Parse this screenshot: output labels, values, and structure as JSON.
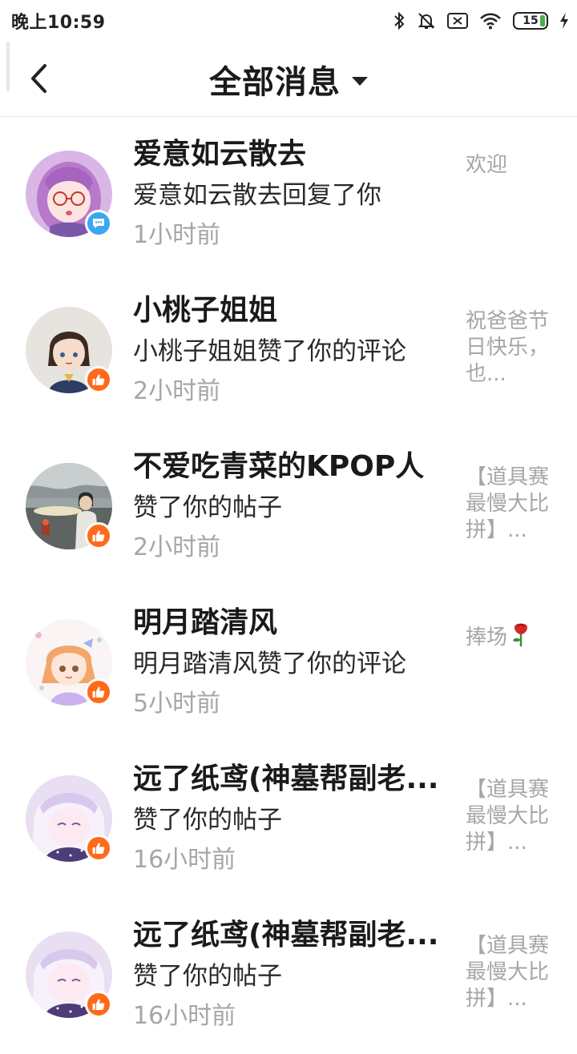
{
  "status_bar": {
    "time": "晚上10:59",
    "battery": "15",
    "icons": [
      "bluetooth-icon",
      "bell-muted-icon",
      "sim-off-icon",
      "wifi-icon",
      "battery-icon",
      "charging-icon"
    ]
  },
  "header": {
    "title": "全部消息",
    "back_icon": "chevron-left-icon",
    "dropdown_icon": "caret-down-icon"
  },
  "colors": {
    "like_badge": "#ff6a1a",
    "reply_badge": "#3aa7f2",
    "muted_text": "#a6a6a6"
  },
  "messages": [
    {
      "name": "爱意如云散去",
      "action": "爱意如云散去回复了你",
      "time": "1小时前",
      "preview": "欢迎",
      "badge": "reply"
    },
    {
      "name": "小桃子姐姐",
      "action": "小桃子姐姐赞了你的评论",
      "time": "2小时前",
      "preview": "祝爸爸节日快乐，也...",
      "badge": "like"
    },
    {
      "name": "不爱吃青菜的KPOP人",
      "action": "赞了你的帖子",
      "time": "2小时前",
      "preview": "【道具赛最慢大比拼】...",
      "badge": "like"
    },
    {
      "name": "明月踏清风",
      "action": "明月踏清风赞了你的评论",
      "time": "5小时前",
      "preview": "捧场",
      "badge": "like"
    },
    {
      "name": "远了纸鸢(神墓帮副老...",
      "action": "赞了你的帖子",
      "time": "16小时前",
      "preview": "【道具赛最慢大比拼】...",
      "badge": "like"
    },
    {
      "name": "远了纸鸢(神墓帮副老...",
      "action": "赞了你的帖子",
      "time": "16小时前",
      "preview": "【道具赛最慢大比拼】...",
      "badge": "like"
    }
  ]
}
